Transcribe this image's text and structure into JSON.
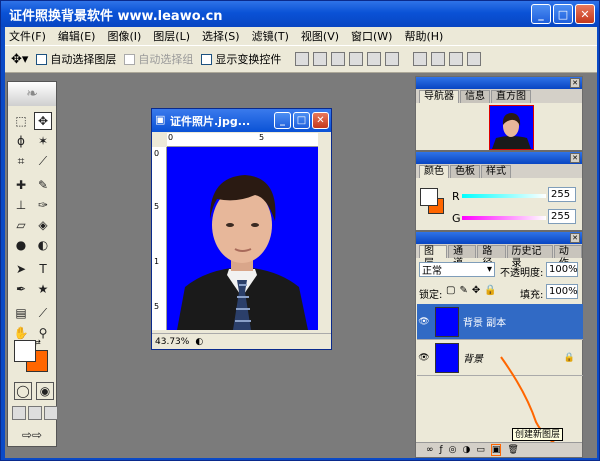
{
  "app": {
    "title": "证件照换背景软件 www.leawo.cn",
    "window_buttons": [
      "minimize-icon",
      "maximize-icon",
      "close-icon"
    ]
  },
  "menu": [
    "文件(F)",
    "编辑(E)",
    "图像(I)",
    "图层(L)",
    "选择(S)",
    "滤镜(T)",
    "视图(V)",
    "窗口(W)",
    "帮助(H)"
  ],
  "options": {
    "auto_select_layer": "自动选择图层",
    "auto_select_group": "自动选择组",
    "show_transform": "显示变换控件"
  },
  "document": {
    "title": "证件照片.jpg...",
    "zoom": "43.73%",
    "ruler_h": [
      "0",
      "5"
    ],
    "ruler_v": [
      "0",
      "5",
      "1",
      "5",
      "2"
    ]
  },
  "navigator": {
    "tabs": [
      "导航器",
      "信息",
      "直方图"
    ]
  },
  "color_panel": {
    "tabs": [
      "颜色",
      "色板",
      "样式"
    ],
    "r_label": "R",
    "r_value": "255",
    "g_label": "G",
    "g_value": "255"
  },
  "layers_panel": {
    "tabs": [
      "图层",
      "通道",
      "路径",
      "历史记录",
      "动作"
    ],
    "blend_mode": "正常",
    "opacity_label": "不透明度:",
    "opacity_value": "100%",
    "lock_label": "锁定:",
    "fill_label": "填充:",
    "fill_value": "100%",
    "layers": [
      {
        "name": "背景 副本",
        "selected": true
      },
      {
        "name": "背景",
        "selected": false
      }
    ],
    "tooltip": "创建新图层"
  },
  "colors": {
    "title_blue": "#0a52d6",
    "foreground": "#ffffff",
    "background": "#ff6600",
    "photo_bg": "#0000ff",
    "layer_selected": "#316ac5"
  }
}
